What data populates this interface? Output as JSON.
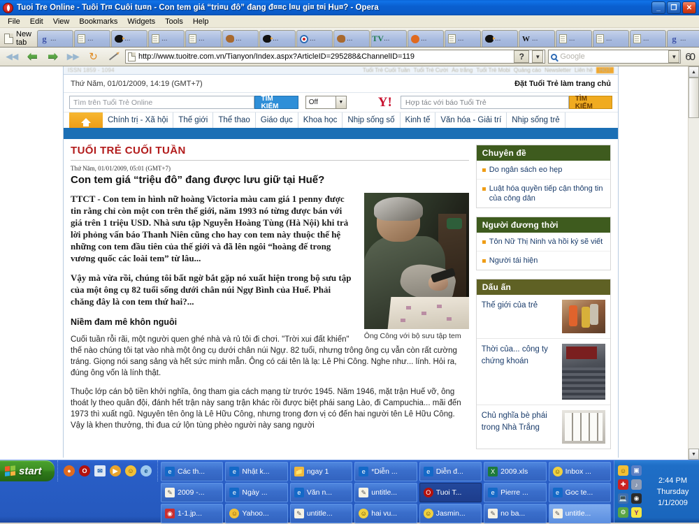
{
  "window": {
    "title": "Tuoi Tre Online - Tuôi Tr¤ Cuôi tu¤n - Con tem giá “tri¤u đô” đang đ¤¤c l¤u gi¤ t¤i Hu¤? - Opera",
    "minimize": "_",
    "restore": "❐",
    "close": "✕"
  },
  "menubar": [
    "File",
    "Edit",
    "View",
    "Bookmarks",
    "Widgets",
    "Tools",
    "Help"
  ],
  "tabbar": {
    "new_tab_label": "New tab",
    "dots": "...",
    "tabs": [
      {
        "icon": "google-favicon"
      },
      {
        "icon": "document-favicon"
      },
      {
        "icon": "bird-favicon"
      },
      {
        "icon": "document-favicon"
      },
      {
        "icon": "document-favicon"
      },
      {
        "icon": "dog-favicon"
      },
      {
        "icon": "bird-favicon"
      },
      {
        "icon": "target-favicon"
      },
      {
        "icon": "dog-favicon"
      },
      {
        "icon": "tv-favicon"
      },
      {
        "icon": "orange-favicon"
      },
      {
        "icon": "document-favicon"
      },
      {
        "icon": "bird-favicon"
      },
      {
        "icon": "wikipedia-favicon"
      },
      {
        "icon": "document-favicon"
      },
      {
        "icon": "document-favicon"
      },
      {
        "icon": "document-favicon"
      },
      {
        "icon": "google-favicon"
      },
      {
        "icon": "document-favicon"
      },
      {
        "icon": "document-favicon"
      },
      {
        "icon": "close-tab-favicon"
      }
    ]
  },
  "addressbar": {
    "url": "http://www.tuoitre.com.vn/Tianyon/Index.aspx?ArticleID=295288&ChannelID=119",
    "help_label": "?",
    "dropdown_caret": "▼",
    "search_placeholder": "Google",
    "zoom_glyph": "60"
  },
  "site": {
    "topbar": {
      "issn": "ISSN 1859 - 1094",
      "links": [
        "Tuổi Trẻ Cuối Tuần",
        "Tuổi Trẻ Cười",
        "Áo trắng",
        "Tuổi Trẻ Mobi",
        "Quảng cáo",
        "Newsletter",
        "Liên hệ"
      ],
      "badge": "HOT"
    },
    "datebar": {
      "datetime": "Thứ Năm, 01/01/2009, 14:19 (GMT+7)",
      "homepage_link": "Đặt Tuổi Trẻ làm trang chủ"
    },
    "search": {
      "placeholder": "Tìm trên Tuổi Trẻ Online",
      "button": "TÌM KIẾM",
      "select_value": "Off",
      "yahoo_logo": "Y!",
      "partner_placeholder": "Hợp tác với báo Tuổi Trẻ",
      "partner_button": "TÌM KIẾM"
    },
    "nav": [
      "Chính trị - Xã hội",
      "Thế giới",
      "Thể thao",
      "Giáo dục",
      "Khoa học",
      "Nhịp sống số",
      "Kinh tế",
      "Văn hóa - Giải trí",
      "Nhịp sống trẻ"
    ],
    "article": {
      "kicker": "TUỔI TRẺ CUỐI TUẦN",
      "date": "Thứ Năm, 01/01/2009, 05:01 (GMT+7)",
      "title": "Con tem giá “triệu đô” đang được lưu giữ tại Huế?",
      "lead": "TTCT - Con tem in hình nữ hoàng Victoria màu cam giá 1 penny được tin rằng chỉ còn một con trên thế giới, năm 1993 nó từng được bán với giá trên 1 triệu USD. Nhà sưu tập Nguyễn Hoàng Tùng (Hà Nội) khi trả lời phỏng vấn báo Thanh Niên cũng cho hay con tem này thuộc thế hệ những con tem đầu tiên của thế giới và đã lên ngôi “hoàng đế trong vương quốc các loài tem” từ lâu...",
      "lead2": "Vậy mà vừa rồi, chúng tôi bất ngờ bắt gặp nó xuất hiện trong bộ sưu tập của một ông cụ 82 tuổi sống dưới chân núi Ngự Bình của Huế. Phải chăng đây là con tem thứ hai?...",
      "caption": "Ông Công với bộ sưu tập tem",
      "subhead": "Niềm đam mê khôn nguôi",
      "para1": "Cuối tuần rỗi rãi, một người quen ghé nhà và rủ tôi đi chơi. \"Trời xui đất khiến\" thế nào chúng tôi tạt vào nhà một ông cụ dưới chân núi Ngự. 82 tuổi, nhưng trông ông cụ vẫn còn rất cường tráng. Giọng nói sang sảng và hết sức minh mẫn. Ông có cái tên là lạ: Lê Phi Công. Nghe như... lính. Hỏi ra, đúng ông vốn là lính thật.",
      "para2": "Thuộc lớp cán bộ tiền khởi nghĩa, ông tham gia cách mạng từ trước 1945. Năm 1946, mặt trận Huế vỡ, ông thoát ly theo quân đội, đánh hết trận này sang trận khác rồi được biệt phái sang Lào, đi Campuchia... mãi đến 1973 thì xuất ngũ. Nguyên tên ông là Lê Hữu Công, nhưng trong đơn vị có đến hai người tên Lê Hữu Công. Vậy là khen thưởng, thi đua cứ lộn tùng phèo người này sang người"
    },
    "sidebar": [
      {
        "heading": "Chuyên đề",
        "style": "green",
        "items": [
          "Do ngân sách eo hẹp",
          "Luật hóa quyền tiếp cận thông tin của công dân"
        ]
      },
      {
        "heading": "Người đương thời",
        "style": "green",
        "items": [
          "Tôn Nữ Thị Ninh và hồi ký sẽ viết",
          "Người tái hiện"
        ]
      }
    ],
    "dauan": {
      "heading": "Dấu ấn",
      "items": [
        {
          "title": "Thế giới của trẻ",
          "thumb": "children-photo"
        },
        {
          "title": "Thời của... công ty chứng khoán",
          "thumb": "trading-floor-photo"
        },
        {
          "title": "Chủ nghĩa bè phái trong Nhà Trắng",
          "thumb": "white-house-photo"
        }
      ]
    }
  },
  "taskbar": {
    "start_label": "start",
    "quicklaunch": [
      "firefox-icon",
      "opera-icon",
      "outlook-icon",
      "media-player-icon",
      "yahoo-messenger-icon",
      "internet-explorer-icon"
    ],
    "tasks": [
      {
        "label": "Các th...",
        "icon": "ie"
      },
      {
        "label": "Nhật k...",
        "icon": "ie"
      },
      {
        "label": "ngay 1",
        "icon": "fold"
      },
      {
        "label": "*Diễn ...",
        "icon": "ie"
      },
      {
        "label": "Diễn đ...",
        "icon": "ie"
      },
      {
        "label": "2009.xls",
        "icon": "xls"
      },
      {
        "label": "Inbox ...",
        "icon": "msg"
      },
      {
        "label": "2009 -...",
        "icon": "pal"
      },
      {
        "label": "Ngày ...",
        "icon": "ie"
      },
      {
        "label": "Văn n...",
        "icon": "ie"
      },
      {
        "label": "untitle...",
        "icon": "pal"
      },
      {
        "label": "Tuoi T...",
        "icon": "op",
        "selected": true
      },
      {
        "label": "Pierre ...",
        "icon": "ie"
      },
      {
        "label": "Goc te...",
        "icon": "ie"
      },
      {
        "label": "1-1.jp...",
        "icon": "cam"
      },
      {
        "label": "Yahoo...",
        "icon": "yim"
      },
      {
        "label": "untitle...",
        "icon": "pal"
      },
      {
        "label": "hai vu...",
        "icon": "msg"
      },
      {
        "label": "Jasmin...",
        "icon": "msg"
      },
      {
        "label": "no ba...",
        "icon": "pal"
      },
      {
        "label": "untitle...",
        "icon": "pal",
        "light": true
      }
    ],
    "tray": {
      "icons": [
        "yahoo-messenger-icon",
        "messenger-icon",
        "antivirus-icon",
        "volume-icon",
        "network-icon",
        "camera-icon",
        "settings-icon",
        "yahoo-icon"
      ],
      "time": "2:44 PM",
      "day": "Thursday",
      "date": "1/1/2009"
    }
  },
  "scrollbar": {
    "up": "▲",
    "down": "▼"
  }
}
